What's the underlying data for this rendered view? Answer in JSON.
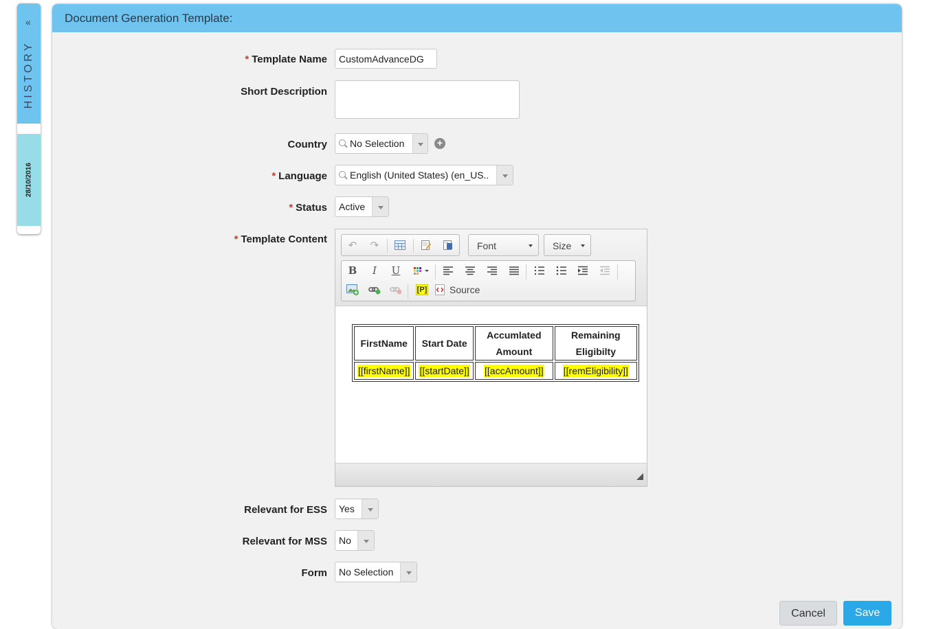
{
  "history": {
    "collapse_glyph": "«",
    "label": "HISTORY",
    "date": "28/10/2016"
  },
  "panel": {
    "title": "Document Generation Template:"
  },
  "form": {
    "template_name": {
      "label": "Template Name",
      "required": "*",
      "value": "CustomAdvanceDG"
    },
    "short_description": {
      "label": "Short Description",
      "value": ""
    },
    "country": {
      "label": "Country",
      "value": "No Selection",
      "add_glyph": "+"
    },
    "language": {
      "label": "Language",
      "required": "*",
      "value": "English (United States) (en_US.."
    },
    "status": {
      "label": "Status",
      "required": "*",
      "value": "Active"
    },
    "template_content": {
      "label": "Template Content",
      "required": "*"
    },
    "relevant_ess": {
      "label": "Relevant for ESS",
      "value": "Yes"
    },
    "relevant_mss": {
      "label": "Relevant for MSS",
      "value": "No"
    },
    "form_field": {
      "label": "Form",
      "value": "No Selection"
    }
  },
  "editor": {
    "toolbar": {
      "font_label": "Font",
      "size_label": "Size",
      "bold": "B",
      "italic": "I",
      "underline": "U",
      "placeholder_btn": "[P]",
      "source_label": "Source"
    },
    "table": {
      "headers": [
        "FirstName",
        "Start Date",
        "Accumlated\nAmount",
        "Remaining\nEligibilty"
      ],
      "row": [
        "[[firstName]]",
        "[[startDate]]",
        "[[accAmount]]",
        "[[remEligibility]]"
      ]
    }
  },
  "actions": {
    "cancel": "Cancel",
    "save": "Save"
  },
  "colors": {
    "header": "#6fc3ef",
    "save": "#2aa8e8",
    "required": "#d9342b",
    "placeholder_highlight": "#ffff00"
  }
}
